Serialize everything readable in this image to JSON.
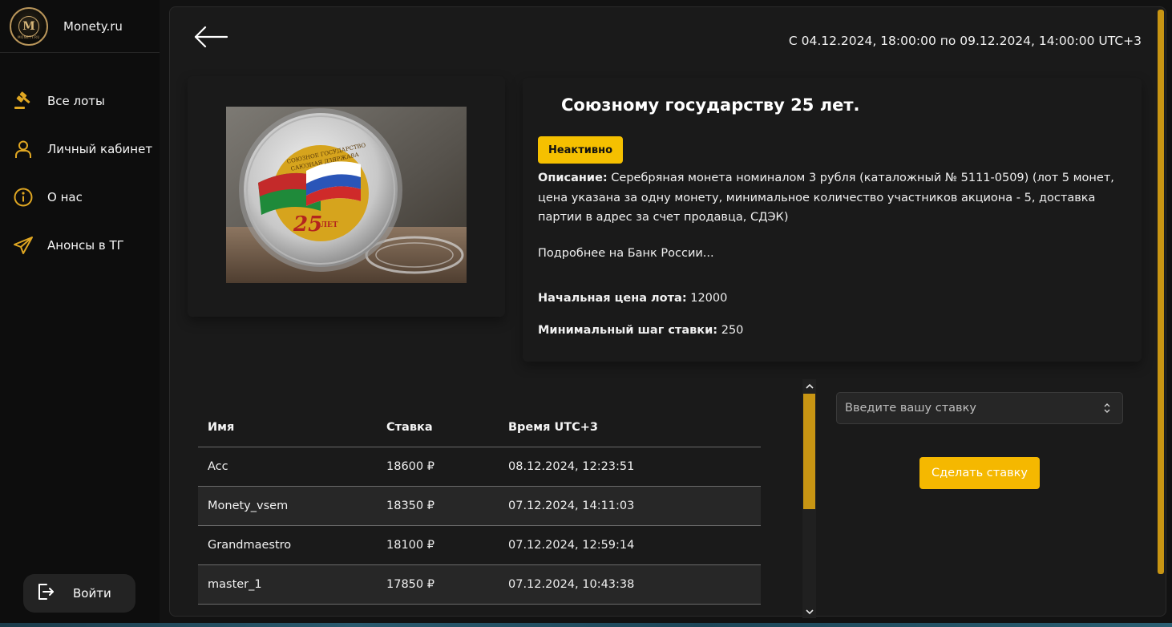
{
  "sidebar": {
    "brand_name": "Monety.ru",
    "logo_letter": "M",
    "logo_sub": "MONETY.RU",
    "items": [
      {
        "label": "Все лоты",
        "icon": "gavel-icon"
      },
      {
        "label": "Личный кабинет",
        "icon": "user-icon"
      },
      {
        "label": "О нас",
        "icon": "info-icon"
      },
      {
        "label": "Анонсы в ТГ",
        "icon": "telegram-icon"
      }
    ],
    "login_label": "Войти"
  },
  "colors": {
    "accent": "#f5c000",
    "button": "#f5b800",
    "scroll_thumb": "#c89513"
  },
  "header": {
    "date_range": "С 04.12.2024, 18:00:00 по 09.12.2024, 14:00:00 UTC+3"
  },
  "lot": {
    "title": "Союзному государству 25 лет.",
    "status": "Неактивно",
    "desc_label": "Описание:",
    "description": " Серебряная монета номиналом 3 рубля (каталожный № 5111-0509) (лот 5 монет, цена указана за одну монету, минимальное количество участников акциона - 5, доставка партии в адрес за счет продавца, СДЭК)",
    "more_link": "Подробнее на Банк России...",
    "start_price_label": "Начальная цена лота:",
    "start_price": " 12000",
    "min_step_label": "Минимальный шаг ставки:",
    "min_step": " 250",
    "coin_text_top": "СОЮЗНОЕ ГОСУДАРСТВО",
    "coin_text_bottom": "САЮЗНАЯ ДЗЯРЖАВА",
    "coin_years": "25",
    "coin_years_word": "ЛЕТ"
  },
  "bids": {
    "headers": {
      "name": "Имя",
      "bid": "Ставка",
      "time": "Время UTC+3"
    },
    "rows": [
      {
        "name": "Acc",
        "bid": "18600 ₽",
        "time": "08.12.2024, 12:23:51"
      },
      {
        "name": "Monety_vsem",
        "bid": "18350 ₽",
        "time": "07.12.2024, 14:11:03"
      },
      {
        "name": "Grandmaestro",
        "bid": "18100 ₽",
        "time": "07.12.2024, 12:59:14"
      },
      {
        "name": "master_1",
        "bid": "17850 ₽",
        "time": "07.12.2024, 10:43:38"
      }
    ]
  },
  "bid_form": {
    "placeholder": "Введите вашу ставку",
    "submit_label": "Сделать ставку"
  }
}
